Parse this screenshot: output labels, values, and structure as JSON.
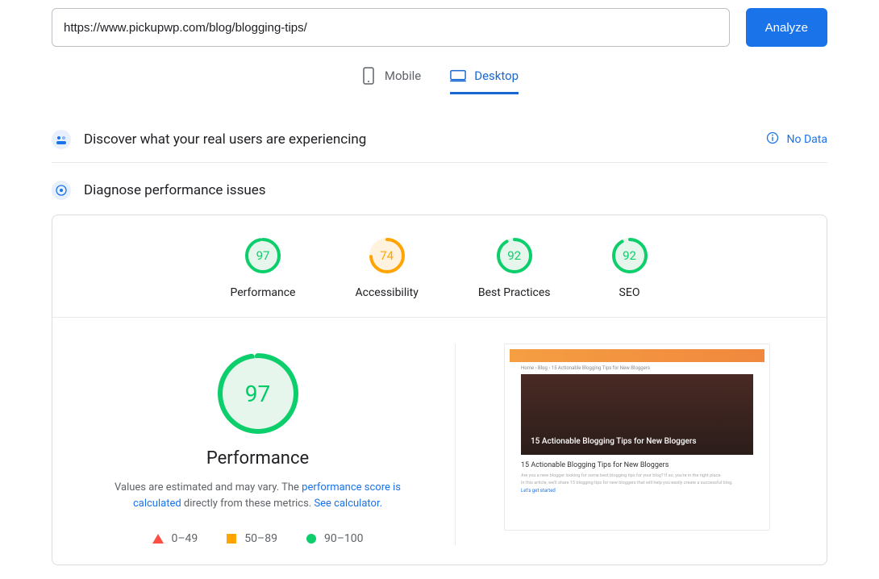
{
  "url_bar": {
    "value": "https://www.pickupwp.com/blog/blogging-tips/",
    "button": "Analyze"
  },
  "tabs": {
    "mobile": "Mobile",
    "desktop": "Desktop",
    "active": "desktop"
  },
  "discover": {
    "title": "Discover what your real users are experiencing",
    "no_data": "No Data"
  },
  "diagnose": {
    "title": "Diagnose performance issues"
  },
  "gauges": [
    {
      "label": "Performance",
      "value": 97,
      "color": "#0cce6b",
      "bg": "#e6f6ec"
    },
    {
      "label": "Accessibility",
      "value": 74,
      "color": "#ffa400",
      "bg": "#fff3e0"
    },
    {
      "label": "Best Practices",
      "value": 92,
      "color": "#0cce6b",
      "bg": "#e6f6ec"
    },
    {
      "label": "SEO",
      "value": 92,
      "color": "#0cce6b",
      "bg": "#e6f6ec"
    }
  ],
  "performance": {
    "big_value": 97,
    "title": "Performance",
    "desc_prefix": "Values are estimated and may vary. The ",
    "desc_link1": "performance score is calculated",
    "desc_mid": " directly from these metrics. ",
    "desc_link2": "See calculator."
  },
  "legend": {
    "low": "0–49",
    "mid": "50–89",
    "high": "90–100"
  },
  "thumbnail": {
    "breadcrumb": "Home › Blog › 15 Actionable Blogging Tips for New Bloggers",
    "hero_title": "15 Actionable Blogging Tips for New Bloggers",
    "body_title": "15 Actionable Blogging Tips for New Bloggers",
    "body_line1": "Are you a new blogger looking for some best blogging tips for your blog? If so, you're in the right place.",
    "body_line2": "In this article, we'll share 15 blogging tips for new bloggers that will help you easily create a successful blog.",
    "body_cta": "Let's get started"
  },
  "colors": {
    "primary": "#1a73e8",
    "good": "#0cce6b",
    "avg": "#ffa400",
    "poor": "#ff4e42"
  }
}
